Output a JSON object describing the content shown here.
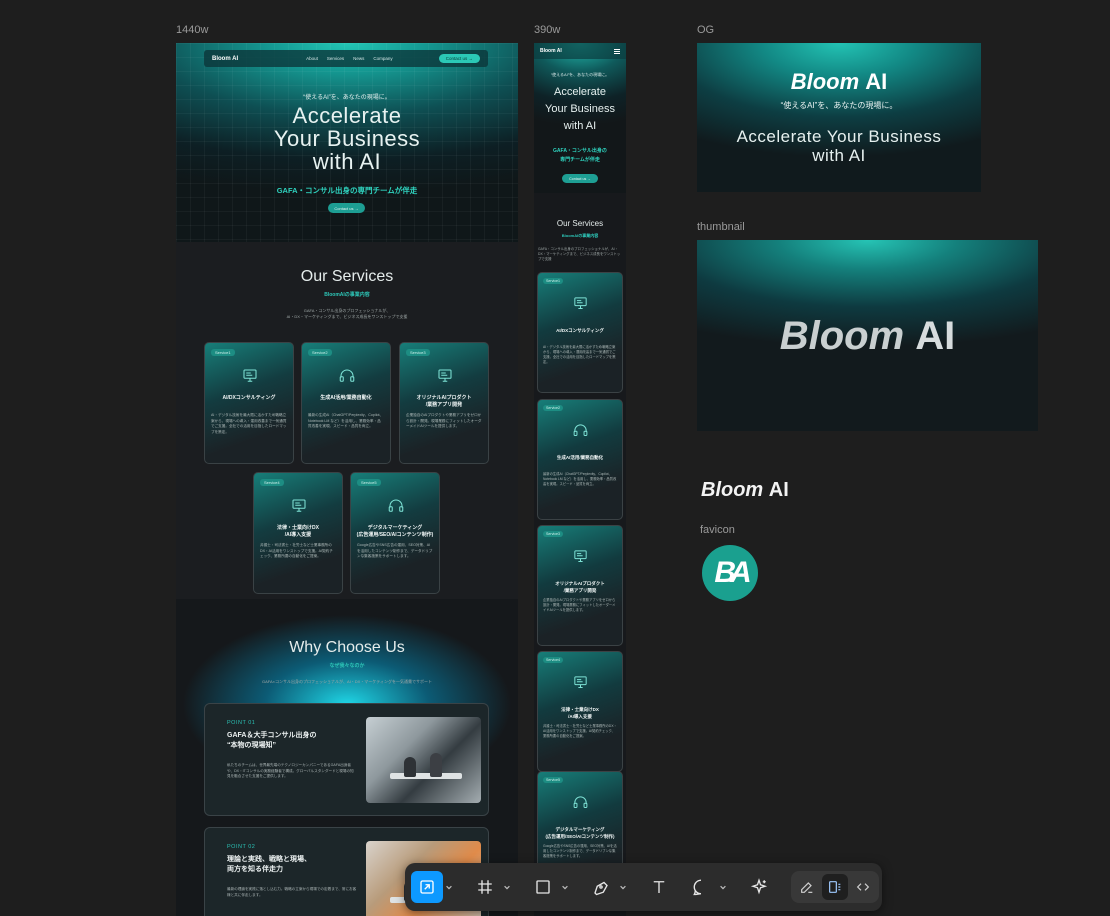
{
  "frame_labels": {
    "desktop": "1440w",
    "mobile": "390w",
    "og": "OG",
    "thumbnail": "thumbnail",
    "favicon": "favicon"
  },
  "brand": {
    "name_bloom": "Bloom",
    "name_ai": "AI",
    "logo_text": "Bloom AI",
    "favicon_text": "BA"
  },
  "desktop": {
    "nav": {
      "links": [
        "About",
        "Services",
        "News",
        "Company"
      ],
      "cta": "Contact us →"
    },
    "hero": {
      "kicker": "“使えるAI”を、あなたの現場に。",
      "title_l1": "Accelerate",
      "title_l2": "Your Business",
      "title_l3": "with AI",
      "sub": "GAFA・コンサル出身の専門チームが伴走",
      "btn": "Contact us →"
    },
    "services": {
      "title": "Our Services",
      "sub": "BloomAIの事業内容",
      "desc_l1": "GAFA・コンサル出身のプロフェッショナルが、",
      "desc_l2": "AI・DX・マーケティングまで、ビジネス成長をワンストップで支援",
      "cards": [
        {
          "tag": "Service1",
          "title_l1": "AI/DXコンサルティング",
          "title_l2": "",
          "body": "AI・デジタル技術を最大限に活かすため戦略立案から、現場への導入・運用改善まで一気通貫でご支援。全社での活用を目指したロードマップを策定。"
        },
        {
          "tag": "Service2",
          "title_l1": "生成AI活用/業務自動化",
          "title_l2": "",
          "body": "最新の生成AI（ChatGPT/Perplexity、Copilot、Notebook LM など）を活用し、業務効率・品質改善を実現。スピード・品質を両立。"
        },
        {
          "tag": "Service3",
          "title_l1": "オリジナルAIプロダクト",
          "title_l2": "/業務アプリ開発",
          "body": "企業独自のAIプロダクトや業務アプリをゼロから設計・開発。現場業務にフィットしたオーダーメイドAIツールを提供します。"
        },
        {
          "tag": "Service4",
          "title_l1": "法律・士業向けDX",
          "title_l2": "/AI導入支援",
          "body": "弁護士・司法書士・社労士など士業事務所のDX・AI活用をワンストップで支援。AI契約チェック、業務所要の自動化をご提案。"
        },
        {
          "tag": "Service5",
          "title_l1": "デジタルマーケティング",
          "title_l2": "(広告運用/SEO/AIコンテンツ制作)",
          "body": "Google広告やSNS広告の運用、SEO対策、AIを活用したコンテンツ制作まで、データドリブンな集客施策をサポートします。"
        }
      ]
    },
    "why": {
      "title": "Why Choose Us",
      "sub": "なぜ我々なのか",
      "desc": "GAFA×コンサル出身のプロフェッショナルが、AI・DX・マーケティングを一気通貫でサポート",
      "points": [
        {
          "label": "POINT 01",
          "title_l1": "GAFA＆大手コンサル出身の",
          "title_l2": "“本物の現場知”",
          "body": "私たちのチームは、世界最先端のテクノロジーカンパニーであるGAFA出身者や、DX・ITコンサルの実務経験者で構成。グローバルスタンダードと現場の知見を融合させた支援をご提供します。"
        },
        {
          "label": "POINT 02",
          "title_l1": "理論と実践、戦略と現場、",
          "title_l2": "両方を知る伴走力",
          "body": "最新の理論を実践に落とし込む力。戦略の立案から現場での定着まで、常にお客様と共に伴走します。"
        }
      ]
    }
  },
  "mobile": {
    "hero": {
      "kicker": "“使えるAI”を、あなたの現場に。",
      "title_l1": "Accelerate",
      "title_l2": "Your Business",
      "title_l3": "with AI",
      "sub_l1": "GAFA・コンサル出身の",
      "sub_l2": "専門チームが伴走",
      "btn": "Contact us →"
    },
    "services": {
      "title": "Our Services",
      "sub": "BloomAIの事業内容",
      "desc": "GAFA・コンサル出身のプロフェッショナルが、AI・DX・マーケティングまで、ビジネス成長をワンストップで支援"
    }
  },
  "og": {
    "kicker": "“使えるAI”を、あなたの現場に。",
    "title_l1": "Accelerate Your Business",
    "title_l2": "with AI"
  },
  "toolbar": {
    "tools": [
      "move-tool",
      "frame-tool",
      "shape-tool",
      "pen-tool",
      "text-tool",
      "comment-tool",
      "actions-tool"
    ],
    "modes": [
      "draw-mode",
      "design-mode",
      "dev-mode"
    ]
  }
}
